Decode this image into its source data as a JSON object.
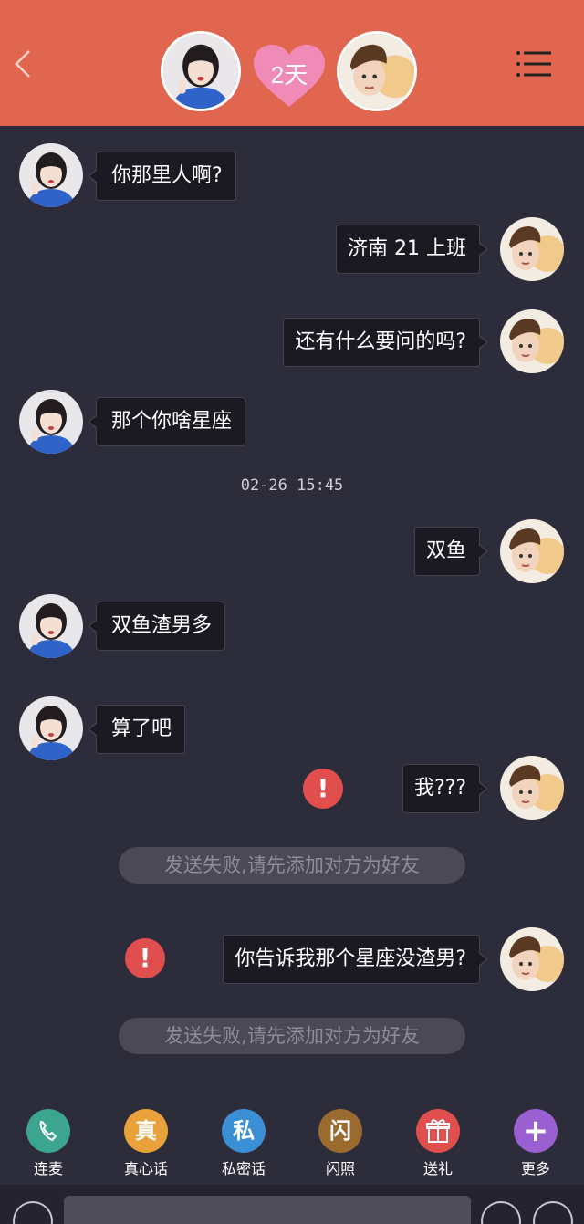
{
  "header": {
    "days_label": "2天",
    "accent": "#e0664f"
  },
  "messages": [
    {
      "side": "left",
      "text": "你那里人啊?"
    },
    {
      "side": "right",
      "text": "济南 21 上班"
    },
    {
      "side": "right",
      "text": "还有什么要问的吗?"
    },
    {
      "side": "left",
      "text": "那个你啥星座"
    },
    {
      "timestamp": "02-26 15:45"
    },
    {
      "side": "right",
      "text": "双鱼"
    },
    {
      "side": "left",
      "text": "双鱼渣男多"
    },
    {
      "side": "left",
      "text": "算了吧"
    },
    {
      "side": "right",
      "text": "我???",
      "failed": true
    },
    {
      "notice": "发送失败,请先添加对方为好友"
    },
    {
      "side": "right",
      "text": "你告诉我那个星座没渣男?",
      "failed": true
    },
    {
      "notice": "发送失败,请先添加对方为好友"
    }
  ],
  "error_glyph": "!",
  "toolbar": [
    {
      "label": "连麦",
      "icon": "phone-icon",
      "color": "#3ba58f"
    },
    {
      "label": "真心话",
      "glyph": "真",
      "icon": "truth-icon",
      "color": "#e9a23b"
    },
    {
      "label": "私密话",
      "glyph": "私",
      "icon": "private-icon",
      "color": "#3b8fd4"
    },
    {
      "label": "闪照",
      "glyph": "闪",
      "icon": "flash-photo-icon",
      "color": "#9b6a2f"
    },
    {
      "label": "送礼",
      "icon": "gift-icon",
      "color": "#e04e4e"
    },
    {
      "label": "更多",
      "glyph": "+",
      "icon": "plus-icon",
      "color": "#9a5fd0"
    }
  ]
}
